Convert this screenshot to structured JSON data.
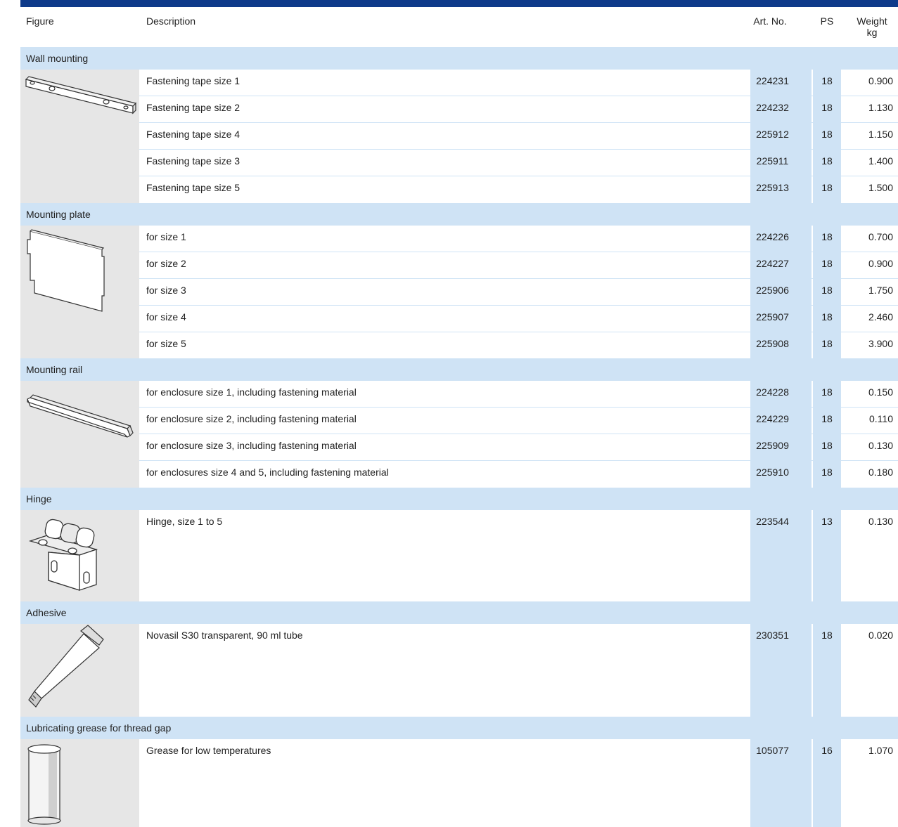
{
  "header": {
    "figure": "Figure",
    "description": "Description",
    "art_no": "Art. No.",
    "ps": "PS",
    "weight": "Weight",
    "weight_unit": "kg"
  },
  "colors": {
    "top_bar": "#0e3a8a",
    "column_fill": "#cfe3f5",
    "figure_fill": "#e6e6e6"
  },
  "groups": [
    {
      "title": "Wall mounting",
      "icon": "fastening-tape-icon",
      "rows": [
        {
          "description": "Fastening tape size 1",
          "art_no": "224231",
          "ps": "18",
          "weight": "0.900"
        },
        {
          "description": "Fastening tape size 2",
          "art_no": "224232",
          "ps": "18",
          "weight": "1.130"
        },
        {
          "description": "Fastening tape size 4",
          "art_no": "225912",
          "ps": "18",
          "weight": "1.150"
        },
        {
          "description": "Fastening tape size 3",
          "art_no": "225911",
          "ps": "18",
          "weight": "1.400"
        },
        {
          "description": "Fastening tape size 5",
          "art_no": "225913",
          "ps": "18",
          "weight": "1.500"
        }
      ]
    },
    {
      "title": "Mounting plate",
      "icon": "mounting-plate-icon",
      "rows": [
        {
          "description": "for size 1",
          "art_no": "224226",
          "ps": "18",
          "weight": "0.700"
        },
        {
          "description": "for size 2",
          "art_no": "224227",
          "ps": "18",
          "weight": "0.900"
        },
        {
          "description": "for size 3",
          "art_no": "225906",
          "ps": "18",
          "weight": "1.750"
        },
        {
          "description": "for size 4",
          "art_no": "225907",
          "ps": "18",
          "weight": "2.460"
        },
        {
          "description": "for size 5",
          "art_no": "225908",
          "ps": "18",
          "weight": "3.900"
        }
      ]
    },
    {
      "title": "Mounting rail",
      "icon": "mounting-rail-icon",
      "rows": [
        {
          "description": "for enclosure size 1, including fastening material",
          "art_no": "224228",
          "ps": "18",
          "weight": "0.150"
        },
        {
          "description": "for enclosure size 2, including fastening material",
          "art_no": "224229",
          "ps": "18",
          "weight": "0.110"
        },
        {
          "description": "for enclosure size 3, including fastening material",
          "art_no": "225909",
          "ps": "18",
          "weight": "0.130"
        },
        {
          "description": "for enclosures size 4 and 5, including fastening material",
          "art_no": "225910",
          "ps": "18",
          "weight": "0.180"
        }
      ]
    },
    {
      "title": "Hinge",
      "icon": "hinge-icon",
      "rows": [
        {
          "description": "Hinge, size 1 to 5",
          "art_no": "223544",
          "ps": "13",
          "weight": "0.130"
        }
      ]
    },
    {
      "title": "Adhesive",
      "icon": "adhesive-tube-icon",
      "rows": [
        {
          "description": "Novasil S30 transparent, 90 ml tube",
          "art_no": "230351",
          "ps": "18",
          "weight": "0.020"
        }
      ]
    },
    {
      "title": "Lubricating grease for thread gap",
      "icon": "grease-can-icon",
      "rows": [
        {
          "description": "Grease for low temperatures",
          "art_no": "105077",
          "ps": "16",
          "weight": "1.070"
        }
      ]
    }
  ]
}
